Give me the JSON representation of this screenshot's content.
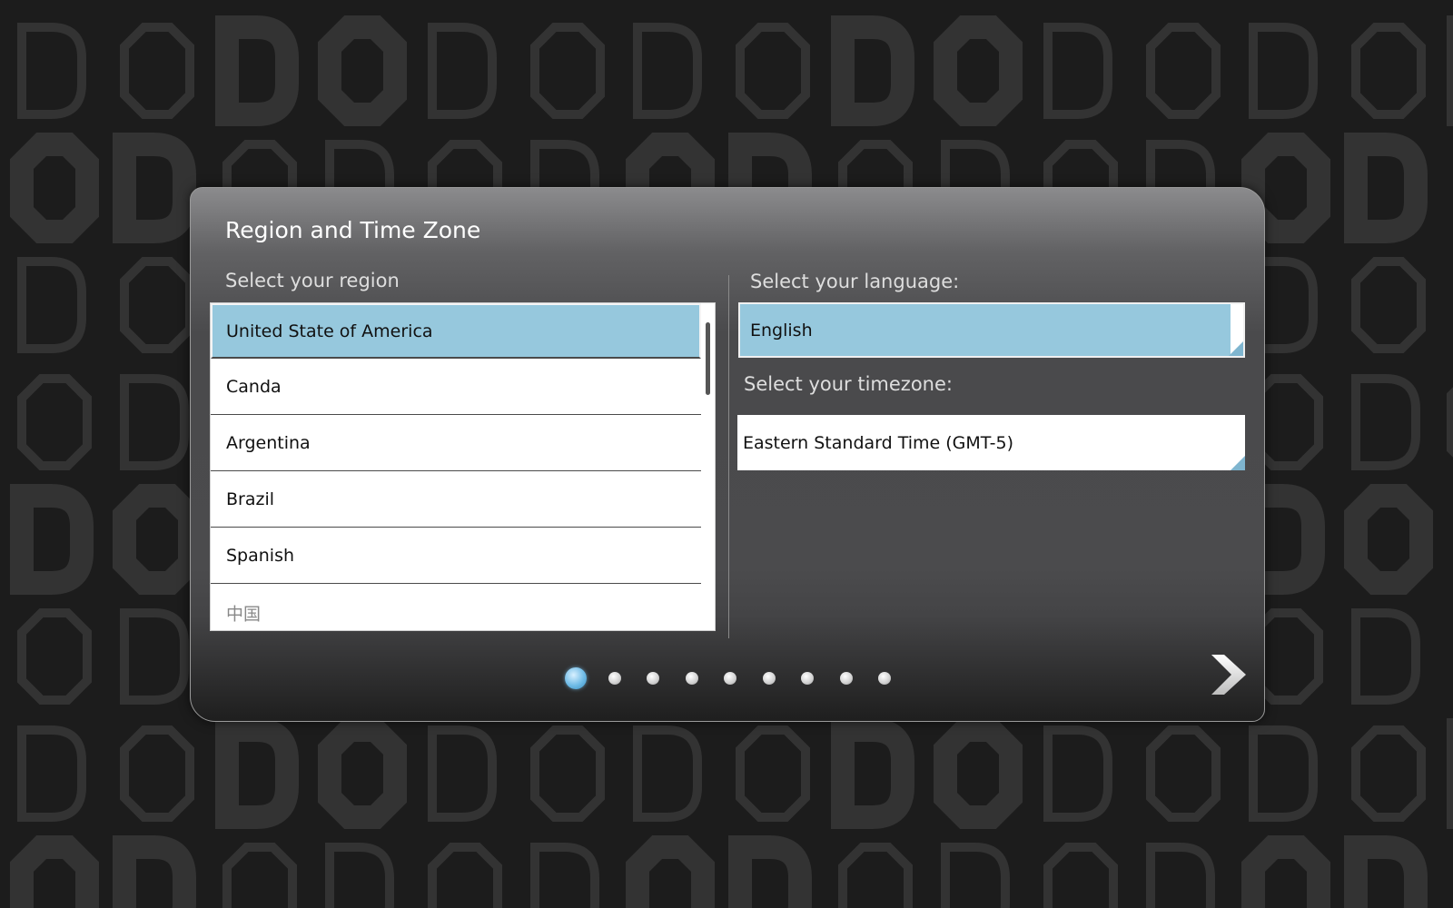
{
  "dialog": {
    "title": "Region and Time Zone"
  },
  "region": {
    "label": "Select your region",
    "items": [
      {
        "label": "United State of America",
        "selected": true
      },
      {
        "label": "Canda",
        "selected": false
      },
      {
        "label": "Argentina",
        "selected": false
      },
      {
        "label": "Brazil",
        "selected": false
      },
      {
        "label": "Spanish",
        "selected": false
      },
      {
        "label": "中国",
        "selected": false
      }
    ]
  },
  "language": {
    "label": "Select your language:",
    "value": "English"
  },
  "timezone": {
    "label": "Select your timezone:",
    "value": "Eastern Standard Time (GMT-5)"
  },
  "pager": {
    "total_pages": 9,
    "current_page": 1
  },
  "navigation": {
    "next_icon": "chevron-right-icon"
  },
  "colors": {
    "background": "#1c1c1c",
    "pattern_letters": "#333333",
    "selected_fill": "#96c8dd",
    "active_dot": "#6fbbe6",
    "title_text": "#ffffff",
    "label_text": "#dedede"
  }
}
